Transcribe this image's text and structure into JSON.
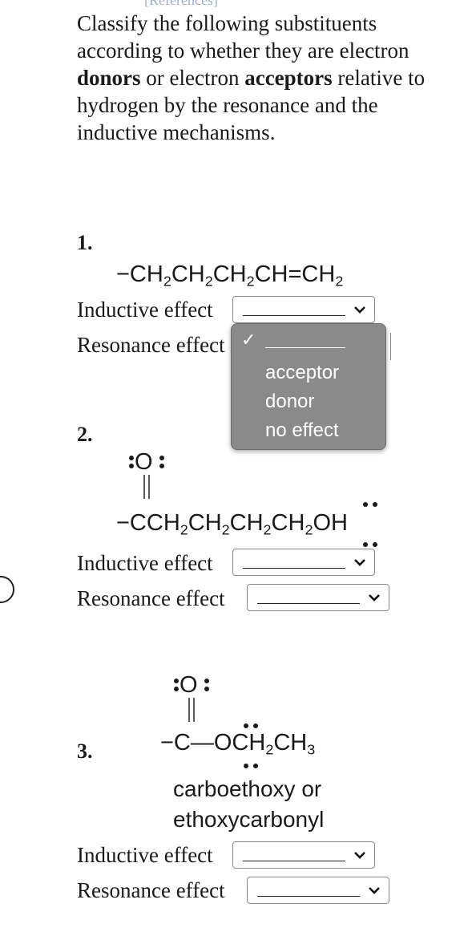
{
  "header": {
    "references_label": "[References]"
  },
  "instructions": {
    "part1": "Classify the following substituents according to whether they are electron ",
    "bold1": "donors",
    "part2": " or electron ",
    "bold2": "acceptors",
    "part3": " relative to hydrogen by the resonance and the inductive mechanisms."
  },
  "items": [
    {
      "number": "1.",
      "formula_parts": [
        "−CH",
        "2",
        "CH",
        "2",
        "CH",
        "2",
        "CH=CH",
        "2"
      ],
      "inductive_label": "Inductive effect",
      "resonance_label": "Resonance effect",
      "inductive_value": "________",
      "resonance_value": "________"
    },
    {
      "number": "2.",
      "oxygen_top": "O",
      "formula_parts": [
        "−CCH",
        "2",
        "CH",
        "2",
        "CH",
        "2",
        "CH",
        "2",
        "OH"
      ],
      "inductive_label": "Inductive effect",
      "resonance_label": "Resonance effect",
      "inductive_value": "________",
      "resonance_value": "________"
    },
    {
      "number": "3.",
      "oxygen_top": "O",
      "formula_parts": [
        "−C—OCH",
        "2",
        "CH",
        "3"
      ],
      "name_line1": "carboethoxy or",
      "name_line2": "ethoxycarbonyl",
      "inductive_label": "Inductive effect",
      "resonance_label": "Resonance effect",
      "inductive_value": "________",
      "resonance_value": "________"
    }
  ],
  "dropdown_menu": {
    "selected_check": "✓",
    "options": [
      "acceptor",
      "donor",
      "no effect"
    ]
  }
}
